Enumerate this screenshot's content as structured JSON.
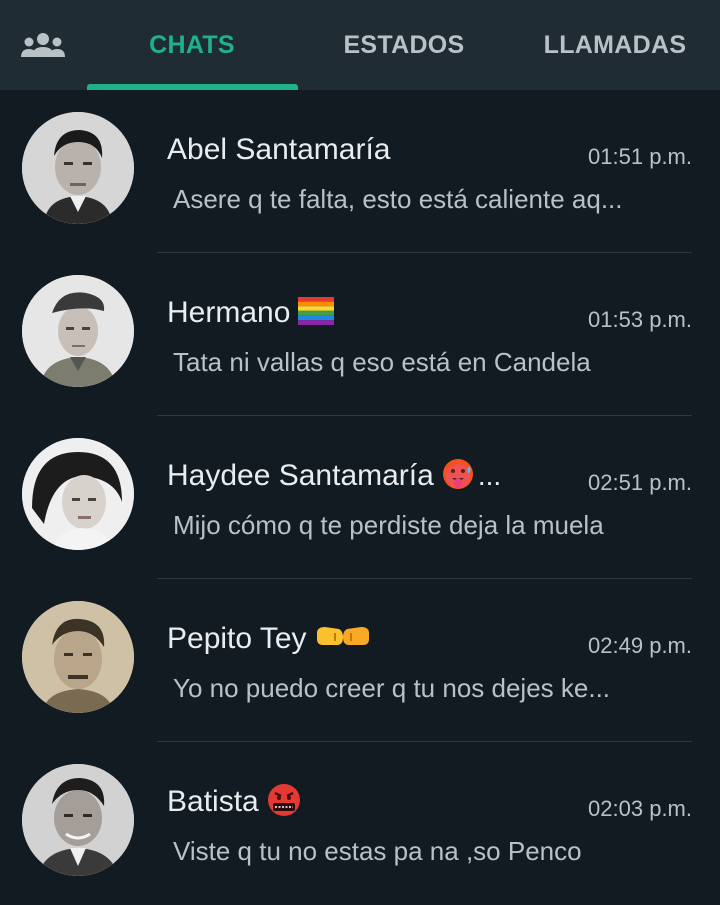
{
  "tabs": [
    {
      "icon": "community-icon"
    },
    {
      "label": "CHATS",
      "active": true
    },
    {
      "label": "ESTADOS",
      "active": false
    },
    {
      "label": "LLAMADAS",
      "active": false
    }
  ],
  "colors": {
    "accent": "#1fb28a",
    "background": "#121b22",
    "header": "#1f2c34",
    "secondary_text": "#b7c1c6"
  },
  "chats": [
    {
      "name": "Abel Santamaría",
      "time": "01:51 p.m.",
      "preview": "Asere q te falta, esto está caliente aq...",
      "emoji": ""
    },
    {
      "name": "Hermano",
      "time": "01:53 p.m.",
      "preview": "Tata ni vallas q eso está en Candela",
      "emoji": "rainbow-flag-emoji"
    },
    {
      "name": "Haydee Santamaría",
      "time": "02:51 p.m.",
      "preview": "Mijo cómo q te perdiste deja la muela",
      "emoji": "hot-face-emoji",
      "truncated": "..."
    },
    {
      "name": "Pepito Tey",
      "time": "02:49 p.m.",
      "preview": "Yo no puedo creer q tu nos dejes ke...",
      "emoji": "fist-bump-emoji"
    },
    {
      "name": "Batista",
      "time": "02:03 p.m.",
      "preview": "Viste q tu no estas pa na ,so Penco",
      "emoji": "cursing-face-emoji"
    }
  ]
}
